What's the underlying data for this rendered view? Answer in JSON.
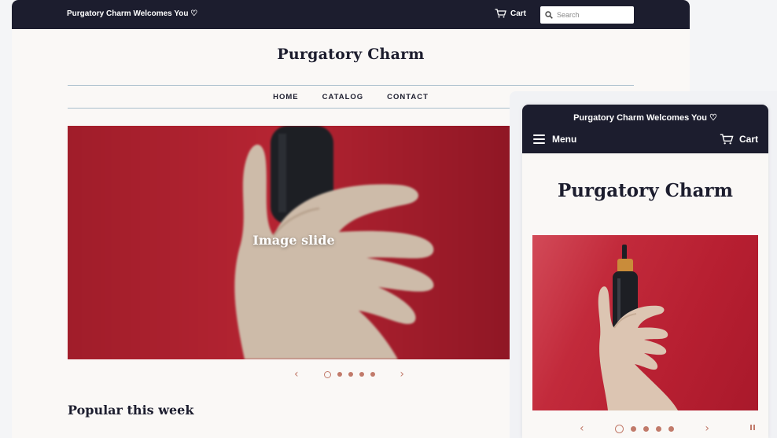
{
  "desktop": {
    "announcement": "Purgatory Charm Welcomes You ♡",
    "cart_label": "Cart",
    "search_placeholder": "Search",
    "logo": "Purgatory Charm",
    "nav": [
      {
        "label": "HOME"
      },
      {
        "label": "CATALOG"
      },
      {
        "label": "CONTACT"
      }
    ],
    "slide_caption": "Image slide",
    "slideshow": {
      "slide_count": 5,
      "active_slide": 1,
      "prev_arrow": "‹",
      "next_arrow": "›"
    },
    "section_title": "Popular this week"
  },
  "mobile": {
    "announcement": "Purgatory Charm Welcomes You ♡",
    "menu_label": "Menu",
    "cart_label": "Cart",
    "logo": "Purgatory Charm",
    "slideshow": {
      "slide_count": 5,
      "active_slide": 1,
      "prev_arrow": "‹",
      "next_arrow": "›"
    }
  },
  "icons": {
    "search": "search-icon",
    "cart": "cart-icon",
    "menu": "hamburger-icon",
    "pause": "pause-icon"
  },
  "colors": {
    "header_bg": "#1c1d2e",
    "page_bg": "#faf8f6",
    "accent": "#c17a6a",
    "slide_red": "#b3212f",
    "nav_border": "#a9bfcc"
  }
}
